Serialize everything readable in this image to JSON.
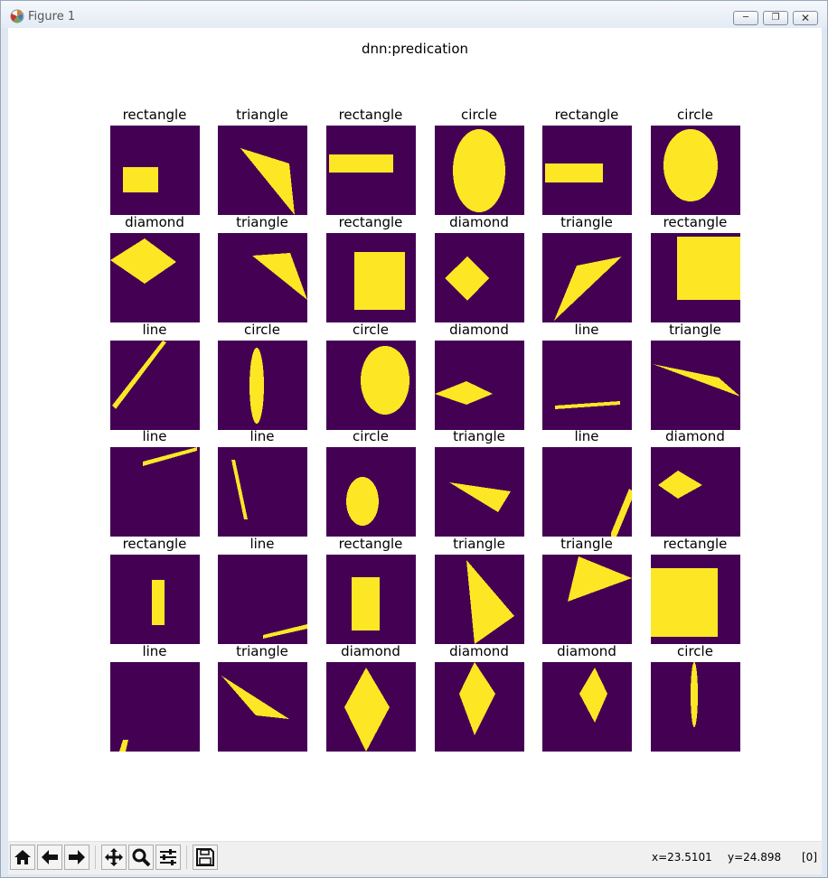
{
  "window": {
    "title": "Figure 1",
    "controls": [
      "minimize",
      "restore",
      "close"
    ]
  },
  "figure": {
    "suptitle": "dnn:predication",
    "background": "#ffffff",
    "panel_bg": "#440154",
    "shape_color": "#fde725",
    "panels": [
      {
        "label": "rectangle",
        "shape": "rect-small"
      },
      {
        "label": "triangle",
        "shape": "triangle-a"
      },
      {
        "label": "rectangle",
        "shape": "rect-wide"
      },
      {
        "label": "circle",
        "shape": "ellipse-big"
      },
      {
        "label": "rectangle",
        "shape": "rect-wide2"
      },
      {
        "label": "circle",
        "shape": "ellipse-mid"
      },
      {
        "label": "diamond",
        "shape": "diamond-flat"
      },
      {
        "label": "triangle",
        "shape": "triangle-b"
      },
      {
        "label": "rectangle",
        "shape": "rect-tall"
      },
      {
        "label": "diamond",
        "shape": "diamond-small"
      },
      {
        "label": "triangle",
        "shape": "triangle-c"
      },
      {
        "label": "rectangle",
        "shape": "rect-square"
      },
      {
        "label": "line",
        "shape": "line-diag"
      },
      {
        "label": "circle",
        "shape": "ellipse-thin"
      },
      {
        "label": "circle",
        "shape": "ellipse-oval"
      },
      {
        "label": "diamond",
        "shape": "diamond-wide"
      },
      {
        "label": "line",
        "shape": "line-horiz"
      },
      {
        "label": "triangle",
        "shape": "triangle-d"
      },
      {
        "label": "line",
        "shape": "line-shallow"
      },
      {
        "label": "line",
        "shape": "line-steep"
      },
      {
        "label": "circle",
        "shape": "ellipse-small"
      },
      {
        "label": "triangle",
        "shape": "triangle-e"
      },
      {
        "label": "line",
        "shape": "line-corner"
      },
      {
        "label": "diamond",
        "shape": "diamond-tiny"
      },
      {
        "label": "rectangle",
        "shape": "rect-thin"
      },
      {
        "label": "line",
        "shape": "line-bottom"
      },
      {
        "label": "rectangle",
        "shape": "rect-mid"
      },
      {
        "label": "triangle",
        "shape": "triangle-f"
      },
      {
        "label": "triangle",
        "shape": "triangle-g"
      },
      {
        "label": "rectangle",
        "shape": "rect-big"
      },
      {
        "label": "line",
        "shape": "line-tiny"
      },
      {
        "label": "triangle",
        "shape": "triangle-h"
      },
      {
        "label": "diamond",
        "shape": "diamond-tall"
      },
      {
        "label": "diamond",
        "shape": "diamond-tall2"
      },
      {
        "label": "diamond",
        "shape": "diamond-tall3"
      },
      {
        "label": "circle",
        "shape": "ellipse-needle"
      }
    ]
  },
  "toolbar": {
    "buttons": [
      {
        "name": "home",
        "icon": "home-icon"
      },
      {
        "name": "back",
        "icon": "arrow-left-icon"
      },
      {
        "name": "forward",
        "icon": "arrow-right-icon"
      },
      {
        "name": "pan",
        "icon": "move-icon"
      },
      {
        "name": "zoom",
        "icon": "zoom-icon"
      },
      {
        "name": "subplots",
        "icon": "sliders-icon"
      },
      {
        "name": "save",
        "icon": "floppy-icon"
      }
    ],
    "x_readout": "x=23.5101",
    "y_readout": "y=24.898",
    "value_readout": "[0]"
  }
}
